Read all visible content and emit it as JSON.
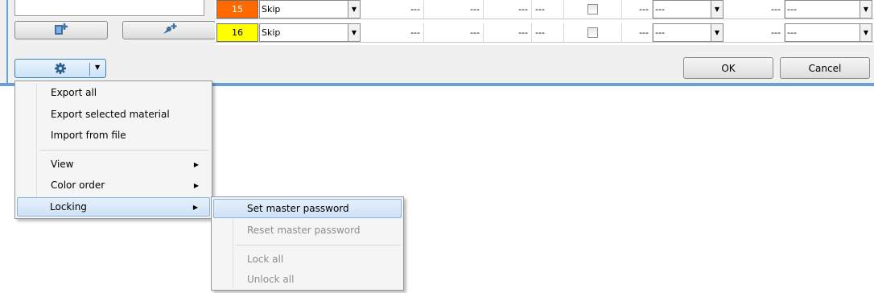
{
  "grid": {
    "rows": [
      {
        "num": "15",
        "num_color": "#ff6a00",
        "num_text_color": "#ffffff",
        "action": "Skip",
        "c1": "---",
        "c2": "---",
        "c3": "---",
        "c4": "---",
        "c5": "---",
        "combo1": "---",
        "c6": "---",
        "combo2": "---"
      },
      {
        "num": "16",
        "num_color": "#ffff00",
        "num_text_color": "#000000",
        "action": "Skip",
        "c1": "---",
        "c2": "---",
        "c3": "---",
        "c4": "---",
        "c5": "---",
        "combo1": "---",
        "c6": "---",
        "combo2": "---"
      }
    ]
  },
  "buttons": {
    "ok": "OK",
    "cancel": "Cancel"
  },
  "icons": {
    "add_material": "add-material-icon",
    "add_color": "add-color-icon",
    "settings": "gear-icon",
    "dropdown": "chevron-down-icon",
    "submenu": "triangle-right-icon"
  },
  "menu": {
    "items": [
      "Export all",
      "Export selected material",
      "Import from file",
      "View",
      "Color order",
      "Locking"
    ]
  },
  "submenu": {
    "items": [
      "Set master password",
      "Reset master password",
      "Lock all",
      "Unlock all"
    ]
  }
}
